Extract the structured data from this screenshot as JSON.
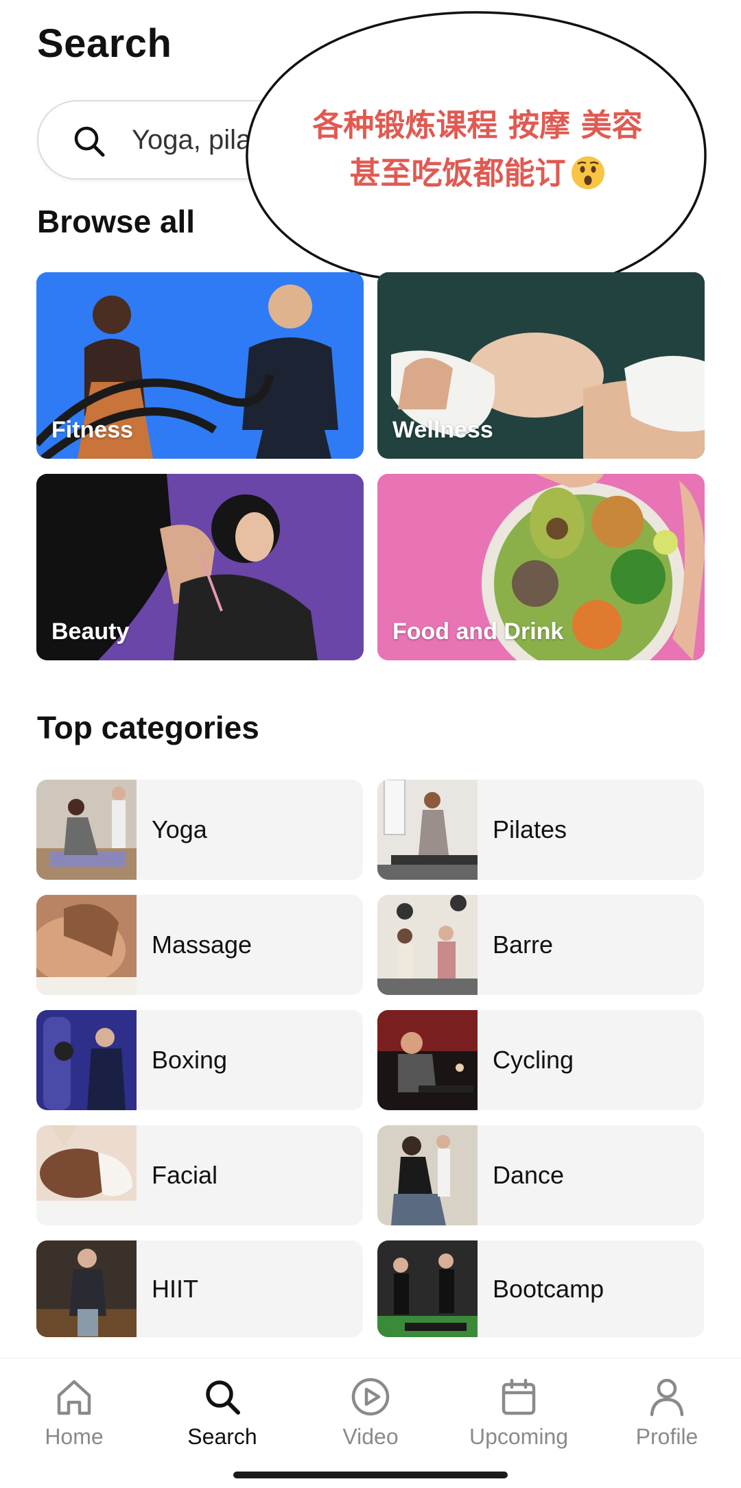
{
  "header": {
    "title": "Search"
  },
  "search": {
    "placeholder": "Yoga, pila"
  },
  "annotation": {
    "line1": "各种锻炼课程 按摩 美容",
    "line2": "甚至吃饭都能订"
  },
  "browse": {
    "title": "Browse all",
    "cards": [
      {
        "label": "Fitness",
        "color": "#2f7bf5"
      },
      {
        "label": "Wellness",
        "color": "#22423f"
      },
      {
        "label": "Beauty",
        "color": "#6a46a8"
      },
      {
        "label": "Food and Drink",
        "color": "#e874b5"
      }
    ]
  },
  "top_categories": {
    "title": "Top categories",
    "items": [
      {
        "label": "Yoga"
      },
      {
        "label": "Pilates"
      },
      {
        "label": "Massage"
      },
      {
        "label": "Barre"
      },
      {
        "label": "Boxing"
      },
      {
        "label": "Cycling"
      },
      {
        "label": "Facial"
      },
      {
        "label": "Dance"
      },
      {
        "label": "HIIT"
      },
      {
        "label": "Bootcamp"
      }
    ]
  },
  "tabs": [
    {
      "label": "Home",
      "icon": "home-icon"
    },
    {
      "label": "Search",
      "icon": "search-icon",
      "active": true
    },
    {
      "label": "Video",
      "icon": "play-circle-icon"
    },
    {
      "label": "Upcoming",
      "icon": "calendar-icon"
    },
    {
      "label": "Profile",
      "icon": "person-icon"
    }
  ]
}
